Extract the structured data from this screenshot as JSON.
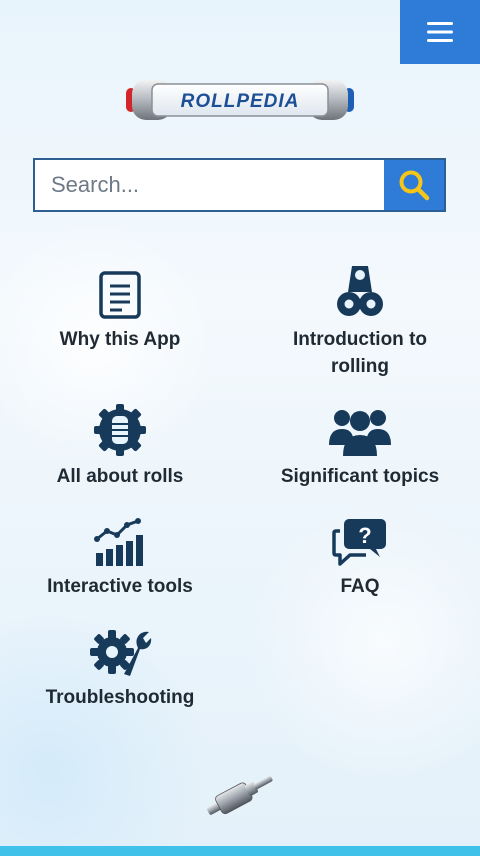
{
  "header": {
    "menu_icon": "hamburger-menu-icon",
    "accent": "#2e7bd8"
  },
  "logo": {
    "text": "ROLLPEDIA"
  },
  "search": {
    "placeholder": "Search...",
    "value": "",
    "icon": "search-icon",
    "icon_color": "#f5c518"
  },
  "tiles": [
    {
      "label": "Why this App",
      "icon": "document-icon"
    },
    {
      "label": "Introduction to rolling",
      "icon": "rolls-stack-icon"
    },
    {
      "label": "All about rolls",
      "icon": "roll-gear-icon"
    },
    {
      "label": "Significant topics",
      "icon": "people-group-icon"
    },
    {
      "label": "Interactive tools",
      "icon": "bar-chart-trend-icon"
    },
    {
      "label": "FAQ",
      "icon": "question-chat-icon"
    },
    {
      "label": "Troubleshooting",
      "icon": "gear-wrench-icon"
    }
  ],
  "footer": {
    "graphic": "steel-roll-graphic",
    "bar_color": "#3fc1ea"
  }
}
